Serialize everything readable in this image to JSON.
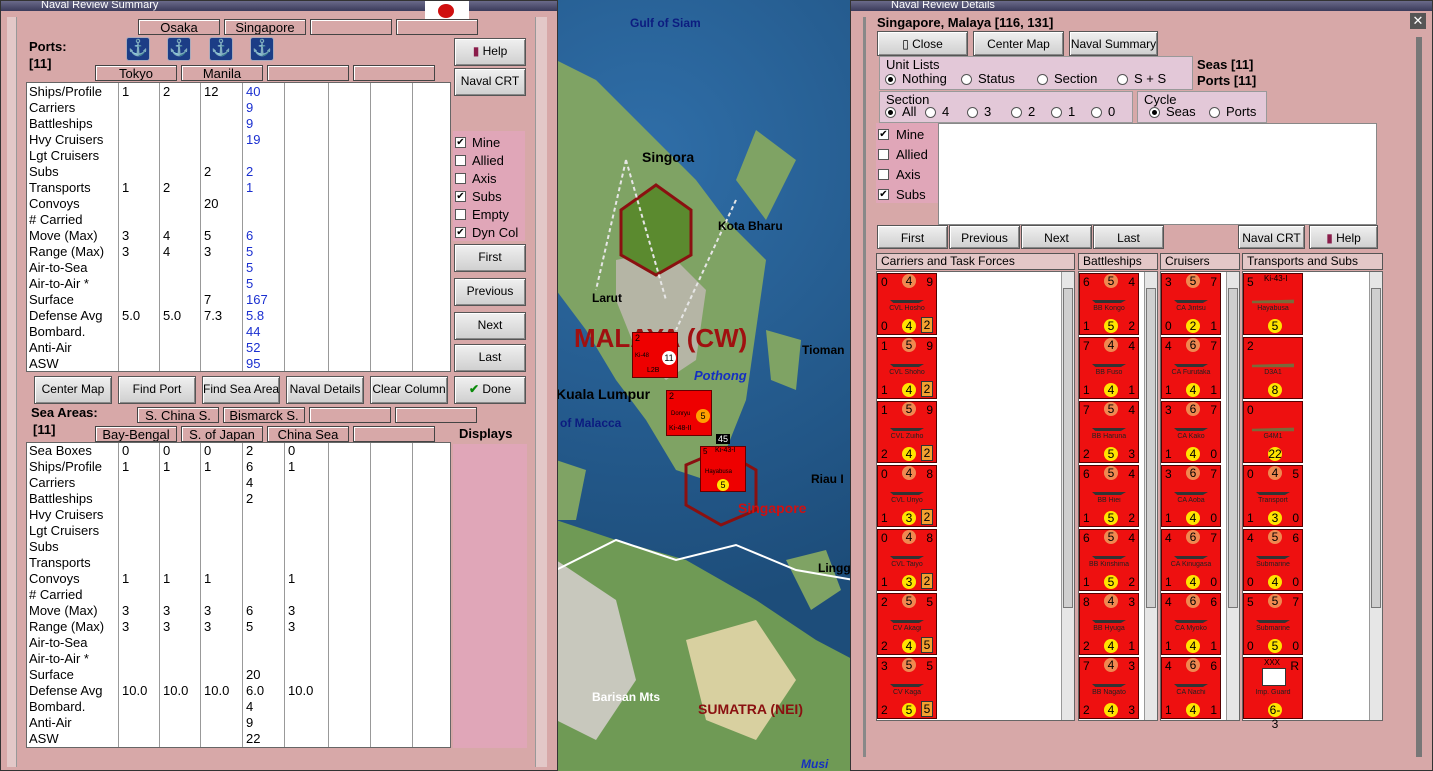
{
  "map": {
    "labels": {
      "gulf": "Gulf of Siam",
      "singora": "Singora",
      "kota_bharu": "Kota Bharu",
      "larut": "Larut",
      "malaya": "MALAYA (CW)",
      "tioman": "Tioman",
      "pothong": "Pothong",
      "kuala_lumpur": "Kuala Lumpur",
      "malacca": "of Malacca",
      "riau": "Riau I",
      "singapore": "Singapore",
      "lingga": "Lingg",
      "barisan": "Barisan Mts",
      "sumatra": "SUMATRA (NEI)",
      "musi": "Musi"
    },
    "units": [
      {
        "top": "2",
        "mid": "L2B",
        "name": "Ki-48",
        "bottom": "11"
      },
      {
        "top": "2",
        "mid": "Ki-48-II",
        "name": "Donryu",
        "bottom": "5"
      },
      {
        "top": "5",
        "mid": "Ki-43-I",
        "name": "Hayabusa",
        "bottom": "5"
      }
    ],
    "stack_count": "45"
  },
  "summary": {
    "title": "Naval Review Summary",
    "ports_label": "Ports:",
    "ports_count": "[11]",
    "port_headers_top": [
      "Osaka",
      "Singapore",
      "",
      ""
    ],
    "port_headers_bottom": [
      "Tokyo",
      "Manila",
      "",
      ""
    ],
    "row_labels": [
      "Ships/Profile",
      "Carriers",
      "Battleships",
      "Hvy Cruisers",
      "Lgt Cruisers",
      "Subs",
      "Transports",
      "Convoys",
      "# Carried",
      "Move (Max)",
      "Range (Max)",
      "Air-to-Sea",
      "Air-to-Air *",
      "Surface",
      "Defense Avg",
      "Bombard.",
      "Anti-Air",
      "ASW"
    ],
    "port_columns": [
      [
        "1",
        "",
        "",
        "",
        "",
        "",
        "1",
        "",
        "",
        "3",
        "3",
        "",
        "",
        "",
        "5.0",
        "",
        "",
        ""
      ],
      [
        "2",
        "",
        "",
        "",
        "",
        "",
        "2",
        "",
        "",
        "4",
        "4",
        "",
        "",
        "",
        "5.0",
        "",
        "",
        ""
      ],
      [
        "12",
        "",
        "",
        "",
        "",
        "2",
        "",
        "20",
        "",
        "5",
        "3",
        "",
        "",
        "7",
        "7.3",
        "",
        "",
        ""
      ],
      [
        "40",
        "9",
        "9",
        "19",
        "",
        "2",
        "1",
        "",
        "",
        "6",
        "5",
        "5",
        "5",
        "167",
        "5.8",
        "44",
        "52",
        "95"
      ]
    ],
    "sea_label": "Sea Areas:",
    "sea_count": "[11]",
    "sea_headers_top": [
      "S. China S.",
      "Bismarck S.",
      "",
      ""
    ],
    "sea_headers_bottom": [
      "Bay-Bengal",
      "S. of Japan",
      "China Sea",
      ""
    ],
    "sea_row_labels": [
      "Sea Boxes",
      "Ships/Profile",
      "Carriers",
      "Battleships",
      "Hvy Cruisers",
      "Lgt Cruisers",
      "Subs",
      "Transports",
      "Convoys",
      "# Carried",
      "Move (Max)",
      "Range (Max)",
      "Air-to-Sea",
      "Air-to-Air *",
      "Surface",
      "Defense Avg",
      "Bombard.",
      "Anti-Air",
      "ASW"
    ],
    "sea_columns": [
      [
        "0",
        "1",
        "",
        "",
        "",
        "",
        "",
        "",
        "1",
        "",
        "3",
        "3",
        "",
        "",
        "",
        "10.0",
        "",
        "",
        ""
      ],
      [
        "0",
        "1",
        "",
        "",
        "",
        "",
        "",
        "",
        "1",
        "",
        "3",
        "3",
        "",
        "",
        "",
        "10.0",
        "",
        "",
        ""
      ],
      [
        "0",
        "1",
        "",
        "",
        "",
        "",
        "",
        "",
        "1",
        "",
        "3",
        "3",
        "",
        "",
        "",
        "10.0",
        "",
        "",
        ""
      ],
      [
        "2",
        "6",
        "4",
        "2",
        "",
        "",
        "",
        "",
        "",
        "",
        "6",
        "5",
        "",
        "",
        "20",
        "6.0",
        "4",
        "9",
        "22"
      ],
      [
        "0",
        "1",
        "",
        "",
        "",
        "",
        "",
        "",
        "1",
        "",
        "3",
        "3",
        "",
        "",
        "",
        "10.0",
        "",
        "",
        ""
      ]
    ],
    "buttons": {
      "help": "Help",
      "naval_crt": "Naval CRT",
      "first": "First",
      "previous": "Previous",
      "next": "Next",
      "last": "Last",
      "center_map": "Center Map",
      "find_port": "Find Port",
      "find_sea": "Find Sea Area",
      "naval_details": "Naval Details",
      "clear_column": "Clear Column",
      "done": "Done"
    },
    "filters": [
      {
        "label": "Mine",
        "checked": true
      },
      {
        "label": "Allied",
        "checked": false
      },
      {
        "label": "Axis",
        "checked": false
      },
      {
        "label": "Subs",
        "checked": true
      },
      {
        "label": "Empty",
        "checked": false
      },
      {
        "label": "Dyn Col",
        "checked": true
      }
    ],
    "displays": "Displays"
  },
  "details": {
    "title": "Naval Review Details",
    "location": "Singapore, Malaya [116, 131]",
    "seas": "Seas [11]",
    "ports": "Ports [11]",
    "buttons": {
      "close": "Close",
      "center_map": "Center Map",
      "naval_summary": "Naval Summary",
      "first": "First",
      "previous": "Previous",
      "next": "Next",
      "last": "Last",
      "naval_crt": "Naval CRT",
      "help": "Help"
    },
    "unit_lists_label": "Unit Lists",
    "unit_lists": [
      "Nothing",
      "Status",
      "Section",
      "S + S"
    ],
    "section_label": "Section",
    "sections": [
      "All",
      "4",
      "3",
      "2",
      "1",
      "0"
    ],
    "cycle_label": "Cycle",
    "cycle": [
      "Seas",
      "Ports"
    ],
    "filters": [
      {
        "label": "Mine",
        "checked": true
      },
      {
        "label": "Allied",
        "checked": false
      },
      {
        "label": "Axis",
        "checked": false
      },
      {
        "label": "Subs",
        "checked": true
      }
    ],
    "list_headers": [
      "Carriers and Task Forces",
      "Battleships",
      "Cruisers",
      "Transports and Subs"
    ],
    "carriers": [
      {
        "a": "0",
        "b": "4",
        "c": "9",
        "name": "CVL Hosho",
        "d": "0",
        "e": "4",
        "f": "2"
      },
      {
        "a": "1",
        "b": "5",
        "c": "9",
        "name": "CVL Shoho",
        "d": "1",
        "e": "4",
        "f": "2"
      },
      {
        "a": "1",
        "b": "5",
        "c": "9",
        "name": "CVL Zuiho",
        "d": "2",
        "e": "4",
        "f": "2"
      },
      {
        "a": "0",
        "b": "4",
        "c": "8",
        "name": "CVL Unyo",
        "d": "1",
        "e": "3",
        "f": "2"
      },
      {
        "a": "0",
        "b": "4",
        "c": "8",
        "name": "CVL Taiyo",
        "d": "1",
        "e": "3",
        "f": "2"
      },
      {
        "a": "2",
        "b": "5",
        "c": "5",
        "name": "CV Akagi",
        "d": "2",
        "e": "4",
        "f": "5"
      },
      {
        "a": "3",
        "b": "5",
        "c": "5",
        "name": "CV Kaga",
        "d": "2",
        "e": "5",
        "f": "5"
      }
    ],
    "battleships": [
      {
        "a": "6",
        "b": "5",
        "c": "4",
        "name": "BB Kongo",
        "d": "1",
        "e": "5",
        "f": "2"
      },
      {
        "a": "7",
        "b": "4",
        "c": "4",
        "name": "BB Fuso",
        "d": "1",
        "e": "4",
        "f": "1"
      },
      {
        "a": "7",
        "b": "5",
        "c": "4",
        "name": "BB Haruna",
        "d": "2",
        "e": "5",
        "f": "3"
      },
      {
        "a": "6",
        "b": "5",
        "c": "4",
        "name": "BB Hiei",
        "d": "1",
        "e": "5",
        "f": "2"
      },
      {
        "a": "6",
        "b": "5",
        "c": "4",
        "name": "BB Kirishima",
        "d": "1",
        "e": "5",
        "f": "2"
      },
      {
        "a": "8",
        "b": "4",
        "c": "3",
        "name": "BB Hyuga",
        "d": "2",
        "e": "4",
        "f": "1"
      },
      {
        "a": "7",
        "b": "4",
        "c": "3",
        "name": "BB Nagato",
        "d": "2",
        "e": "4",
        "f": "3"
      }
    ],
    "cruisers": [
      {
        "a": "3",
        "b": "5",
        "c": "7",
        "name": "CA Jintsu",
        "d": "0",
        "e": "2",
        "f": "1"
      },
      {
        "a": "4",
        "b": "6",
        "c": "7",
        "name": "CA Furutaka",
        "d": "1",
        "e": "4",
        "f": "1"
      },
      {
        "a": "3",
        "b": "6",
        "c": "7",
        "name": "CA Kako",
        "d": "1",
        "e": "4",
        "f": "0"
      },
      {
        "a": "3",
        "b": "6",
        "c": "7",
        "name": "CA Aoba",
        "d": "1",
        "e": "4",
        "f": "0"
      },
      {
        "a": "4",
        "b": "6",
        "c": "7",
        "name": "CA Kinugasa",
        "d": "1",
        "e": "4",
        "f": "0"
      },
      {
        "a": "4",
        "b": "6",
        "c": "6",
        "name": "CA Myoko",
        "d": "1",
        "e": "4",
        "f": "1"
      },
      {
        "a": "4",
        "b": "6",
        "c": "6",
        "name": "CA Nachi",
        "d": "1",
        "e": "4",
        "f": "1"
      }
    ],
    "transports": [
      {
        "a": "5",
        "b": "",
        "c": "",
        "name": "Hayabusa",
        "d": "",
        "e": "5",
        "f": "",
        "top": "Ki-43-I"
      },
      {
        "a": "2",
        "b": "",
        "c": "",
        "name": "D3A1",
        "d": "",
        "e": "8",
        "f": ""
      },
      {
        "a": "0",
        "b": "",
        "c": "",
        "name": "G4M1",
        "d": "",
        "e": "22",
        "f": ""
      },
      {
        "a": "0",
        "b": "4",
        "c": "5",
        "name": "Transport",
        "d": "1",
        "e": "3",
        "f": "0"
      },
      {
        "a": "4",
        "b": "5",
        "c": "6",
        "name": "Submarine",
        "d": "0",
        "e": "4",
        "f": "0"
      },
      {
        "a": "5",
        "b": "5",
        "c": "7",
        "name": "Submarine",
        "d": "0",
        "e": "5",
        "f": "0"
      },
      {
        "a": "",
        "b": "",
        "c": "R",
        "name": "Imp. Guard",
        "d": "",
        "e": "6-3",
        "f": "",
        "top": "XXX"
      }
    ]
  }
}
